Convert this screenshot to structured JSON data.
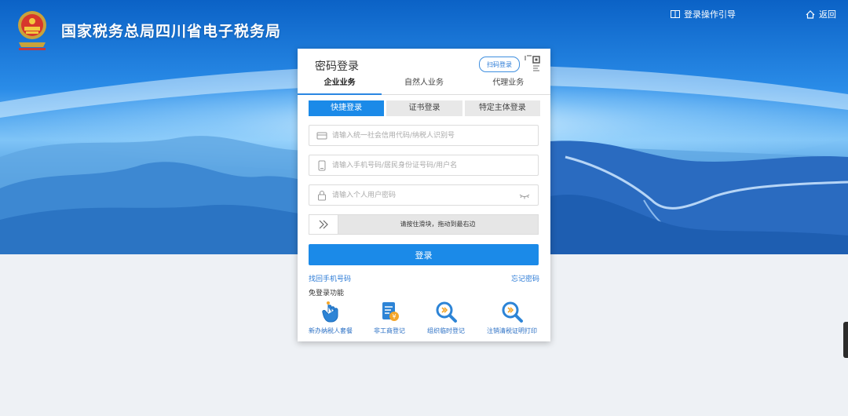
{
  "header": {
    "site_title": "国家税务总局四川省电子税务局",
    "guide_label": "登录操作引导",
    "back_label": "返回"
  },
  "login": {
    "title": "密码登录",
    "qr_label": "扫码登录",
    "biz_tabs": [
      "企业业务",
      "自然人业务",
      "代理业务"
    ],
    "login_tabs": [
      "快捷登录",
      "证书登录",
      "特定主体登录"
    ],
    "credit_code_placeholder": "请输入统一社会信用代码/纳税人识别号",
    "account_placeholder": "请输入手机号码/居民身份证号码/用户名",
    "password_placeholder": "请输入个人用户密码",
    "slider_text": "请按住滑块，拖动到最右边",
    "login_button": "登录",
    "retrieve_phone": "找回手机号码",
    "forgot_password": "忘记密码",
    "no_login_title": "免登录功能",
    "quick_items": [
      "新办纳税人套餐",
      "非工商登记",
      "组织临时登记",
      "注销清税证明打印"
    ]
  },
  "colors": {
    "primary": "#1b8ae8",
    "link": "#2a7ad6",
    "hero_top": "#0a63c9"
  }
}
